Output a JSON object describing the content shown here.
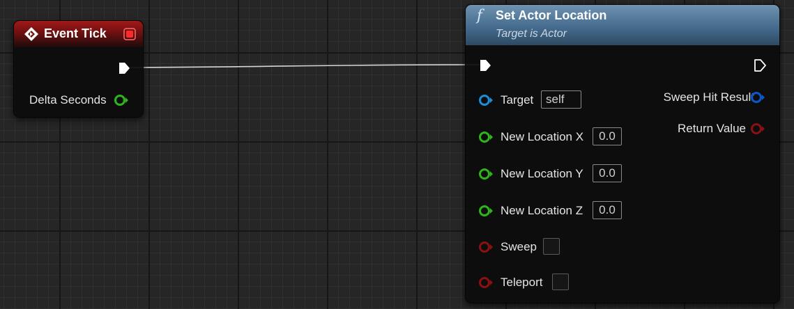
{
  "colors": {
    "event_header": "#a21919",
    "function_header": "#456c8e",
    "float_pin": "#2fb51c",
    "object_pin": "#1c8dd6",
    "struct_pin": "#0a58c8",
    "bool_pin": "#8b1111",
    "exec_pin": "#ffffff"
  },
  "event_tick": {
    "title": "Event Tick",
    "header_icon": "event-diamond-icon",
    "stop_icon": "red-square-icon",
    "delta_seconds_label": "Delta Seconds"
  },
  "set_actor_location": {
    "title": "Set Actor Location",
    "function_icon": "f",
    "subtitle": "Target is Actor",
    "inputs": {
      "target": {
        "label": "Target",
        "value": "self"
      },
      "new_location_x": {
        "label": "New Location X",
        "value": "0.0"
      },
      "new_location_y": {
        "label": "New Location Y",
        "value": "0.0"
      },
      "new_location_z": {
        "label": "New Location Z",
        "value": "0.0"
      },
      "sweep": {
        "label": "Sweep",
        "checked": false
      },
      "teleport": {
        "label": "Teleport",
        "checked": false
      }
    },
    "outputs": {
      "sweep_hit_result": {
        "label": "Sweep Hit Result"
      },
      "return_value": {
        "label": "Return Value"
      }
    }
  }
}
